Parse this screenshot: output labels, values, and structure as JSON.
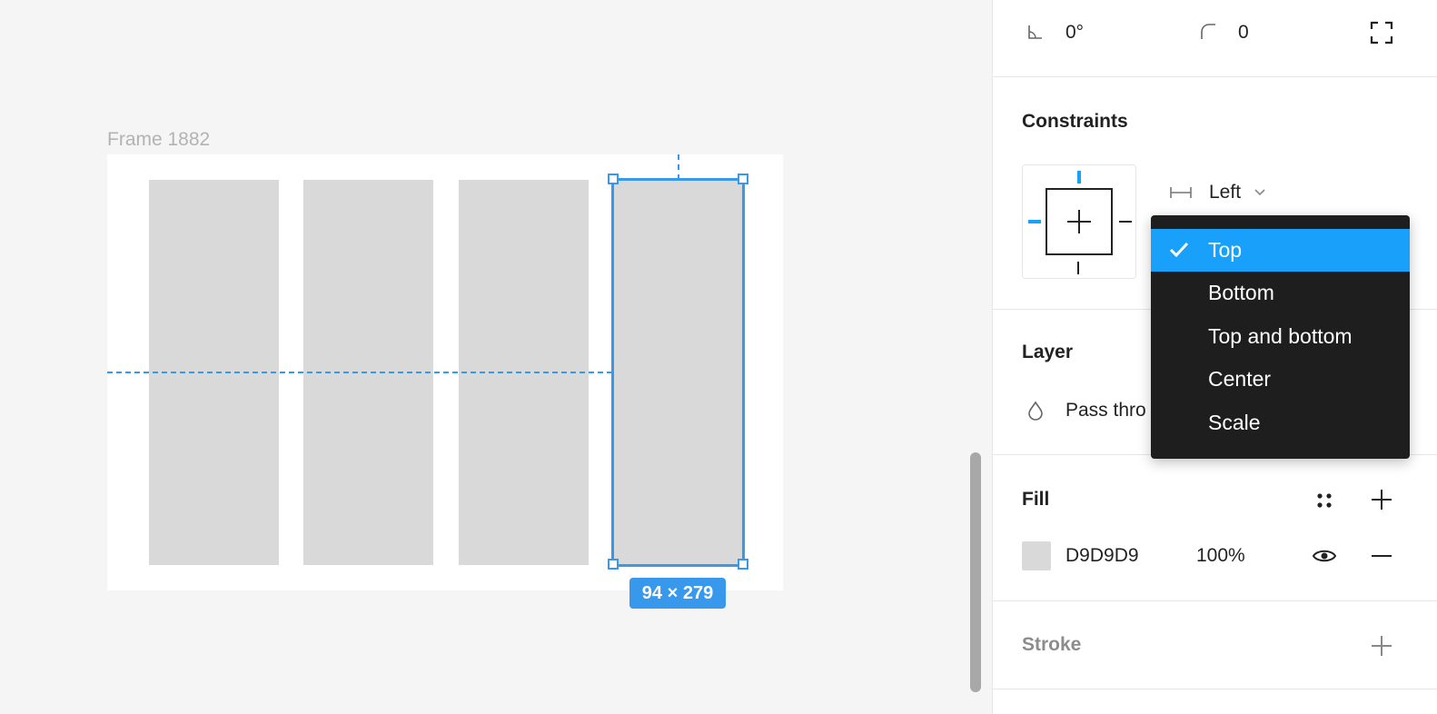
{
  "canvas": {
    "frame_label": "Frame 1882",
    "selection_size": "94 × 279",
    "colors": {
      "selection": "#3898ec",
      "rect_fill": "#d9d9d9"
    }
  },
  "panel": {
    "transform": {
      "rotation": "0°",
      "corner_radius": "0"
    },
    "constraints": {
      "title": "Constraints",
      "horizontal": "Left"
    },
    "layer": {
      "title": "Layer",
      "blend_mode_visible": "Pass thro"
    },
    "fill": {
      "title": "Fill",
      "hex": "D9D9D9",
      "opacity": "100%"
    },
    "stroke": {
      "title": "Stroke"
    }
  },
  "dropdown": {
    "items": [
      "Top",
      "Bottom",
      "Top and bottom",
      "Center",
      "Scale"
    ],
    "selected": "Top",
    "colors": {
      "bg": "#1e1e1e",
      "active": "#18a0fb"
    }
  }
}
